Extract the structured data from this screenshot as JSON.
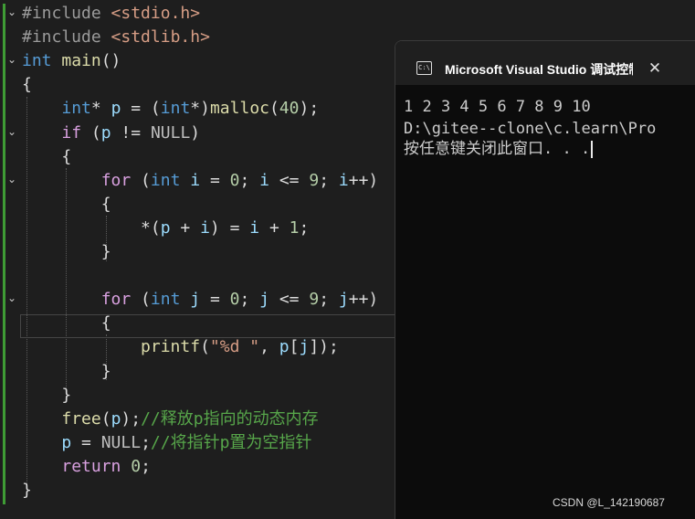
{
  "editor": {
    "lines": [
      {
        "segments": [
          {
            "c": "pp",
            "t": "#include "
          },
          {
            "c": "str",
            "t": "<stdio.h>"
          }
        ]
      },
      {
        "segments": [
          {
            "c": "pp",
            "t": "#include "
          },
          {
            "c": "str",
            "t": "<stdlib.h>"
          }
        ]
      },
      {
        "segments": [
          {
            "c": "kw",
            "t": "int "
          },
          {
            "c": "fn",
            "t": "main"
          },
          {
            "c": "pl",
            "t": "()"
          }
        ]
      },
      {
        "segments": [
          {
            "c": "pl",
            "t": "{"
          }
        ]
      },
      {
        "segments": [
          {
            "c": "pl",
            "t": "    "
          },
          {
            "c": "kw",
            "t": "int"
          },
          {
            "c": "pl",
            "t": "* "
          },
          {
            "c": "var",
            "t": "p"
          },
          {
            "c": "pl",
            "t": " = ("
          },
          {
            "c": "kw",
            "t": "int"
          },
          {
            "c": "pl",
            "t": "*)"
          },
          {
            "c": "fn",
            "t": "malloc"
          },
          {
            "c": "pl",
            "t": "("
          },
          {
            "c": "num",
            "t": "40"
          },
          {
            "c": "pl",
            "t": ");"
          }
        ]
      },
      {
        "segments": [
          {
            "c": "pl",
            "t": "    "
          },
          {
            "c": "kw2",
            "t": "if"
          },
          {
            "c": "pl",
            "t": " ("
          },
          {
            "c": "var",
            "t": "p"
          },
          {
            "c": "pl",
            "t": " != "
          },
          {
            "c": "mac",
            "t": "NULL"
          },
          {
            "c": "pl",
            "t": ")"
          }
        ]
      },
      {
        "segments": [
          {
            "c": "pl",
            "t": "    {"
          }
        ]
      },
      {
        "segments": [
          {
            "c": "pl",
            "t": "        "
          },
          {
            "c": "kw2",
            "t": "for"
          },
          {
            "c": "pl",
            "t": " ("
          },
          {
            "c": "kw",
            "t": "int"
          },
          {
            "c": "pl",
            "t": " "
          },
          {
            "c": "var",
            "t": "i"
          },
          {
            "c": "pl",
            "t": " = "
          },
          {
            "c": "num",
            "t": "0"
          },
          {
            "c": "pl",
            "t": "; "
          },
          {
            "c": "var",
            "t": "i"
          },
          {
            "c": "pl",
            "t": " <= "
          },
          {
            "c": "num",
            "t": "9"
          },
          {
            "c": "pl",
            "t": "; "
          },
          {
            "c": "var",
            "t": "i"
          },
          {
            "c": "pl",
            "t": "++)"
          }
        ]
      },
      {
        "segments": [
          {
            "c": "pl",
            "t": "        {"
          }
        ]
      },
      {
        "segments": [
          {
            "c": "pl",
            "t": "            *("
          },
          {
            "c": "var",
            "t": "p"
          },
          {
            "c": "pl",
            "t": " + "
          },
          {
            "c": "var",
            "t": "i"
          },
          {
            "c": "pl",
            "t": ") = "
          },
          {
            "c": "var",
            "t": "i"
          },
          {
            "c": "pl",
            "t": " + "
          },
          {
            "c": "num",
            "t": "1"
          },
          {
            "c": "pl",
            "t": ";"
          }
        ]
      },
      {
        "segments": [
          {
            "c": "pl",
            "t": "        }"
          }
        ]
      },
      {
        "segments": [
          {
            "c": "pl",
            "t": ""
          }
        ]
      },
      {
        "segments": [
          {
            "c": "pl",
            "t": "        "
          },
          {
            "c": "kw2",
            "t": "for"
          },
          {
            "c": "pl",
            "t": " ("
          },
          {
            "c": "kw",
            "t": "int"
          },
          {
            "c": "pl",
            "t": " "
          },
          {
            "c": "var",
            "t": "j"
          },
          {
            "c": "pl",
            "t": " = "
          },
          {
            "c": "num",
            "t": "0"
          },
          {
            "c": "pl",
            "t": "; "
          },
          {
            "c": "var",
            "t": "j"
          },
          {
            "c": "pl",
            "t": " <= "
          },
          {
            "c": "num",
            "t": "9"
          },
          {
            "c": "pl",
            "t": "; "
          },
          {
            "c": "var",
            "t": "j"
          },
          {
            "c": "pl",
            "t": "++)"
          }
        ]
      },
      {
        "segments": [
          {
            "c": "pl",
            "t": "        {"
          }
        ]
      },
      {
        "segments": [
          {
            "c": "pl",
            "t": "            "
          },
          {
            "c": "fn",
            "t": "printf"
          },
          {
            "c": "pl",
            "t": "("
          },
          {
            "c": "str",
            "t": "\"%d \""
          },
          {
            "c": "pl",
            "t": ", "
          },
          {
            "c": "var",
            "t": "p"
          },
          {
            "c": "pl",
            "t": "["
          },
          {
            "c": "var",
            "t": "j"
          },
          {
            "c": "pl",
            "t": "]);"
          }
        ]
      },
      {
        "segments": [
          {
            "c": "pl",
            "t": "        }"
          }
        ]
      },
      {
        "segments": [
          {
            "c": "pl",
            "t": "    }"
          }
        ]
      },
      {
        "segments": [
          {
            "c": "pl",
            "t": "    "
          },
          {
            "c": "fn",
            "t": "free"
          },
          {
            "c": "pl",
            "t": "("
          },
          {
            "c": "var",
            "t": "p"
          },
          {
            "c": "pl",
            "t": ");"
          },
          {
            "c": "cm",
            "t": "//释放p指向的动态内存"
          }
        ]
      },
      {
        "segments": [
          {
            "c": "pl",
            "t": "    "
          },
          {
            "c": "var",
            "t": "p"
          },
          {
            "c": "pl",
            "t": " = "
          },
          {
            "c": "mac",
            "t": "NULL"
          },
          {
            "c": "pl",
            "t": ";"
          },
          {
            "c": "cm",
            "t": "//将指针p置为空指针"
          }
        ]
      },
      {
        "segments": [
          {
            "c": "pl",
            "t": "    "
          },
          {
            "c": "kw2",
            "t": "return"
          },
          {
            "c": "pl",
            "t": " "
          },
          {
            "c": "num",
            "t": "0"
          },
          {
            "c": "pl",
            "t": ";"
          }
        ]
      },
      {
        "segments": [
          {
            "c": "pl",
            "t": "}"
          }
        ]
      }
    ],
    "fold_markers": [
      {
        "line": 0,
        "glyph": "⌄"
      },
      {
        "line": 2,
        "glyph": "⌄"
      },
      {
        "line": 5,
        "glyph": "⌄"
      },
      {
        "line": 7,
        "glyph": "⌄"
      },
      {
        "line": 12,
        "glyph": "⌄"
      }
    ]
  },
  "console": {
    "icon_label": "C:\\",
    "title": "Microsoft Visual Studio 调试控制台",
    "close_glyph": "✕",
    "output_lines": [
      "1 2 3 4 5 6 7 8 9 10",
      "D:\\gitee--clone\\c.learn\\Pro",
      "按任意键关闭此窗口. . ."
    ]
  },
  "watermark": "CSDN @L_142190687"
}
